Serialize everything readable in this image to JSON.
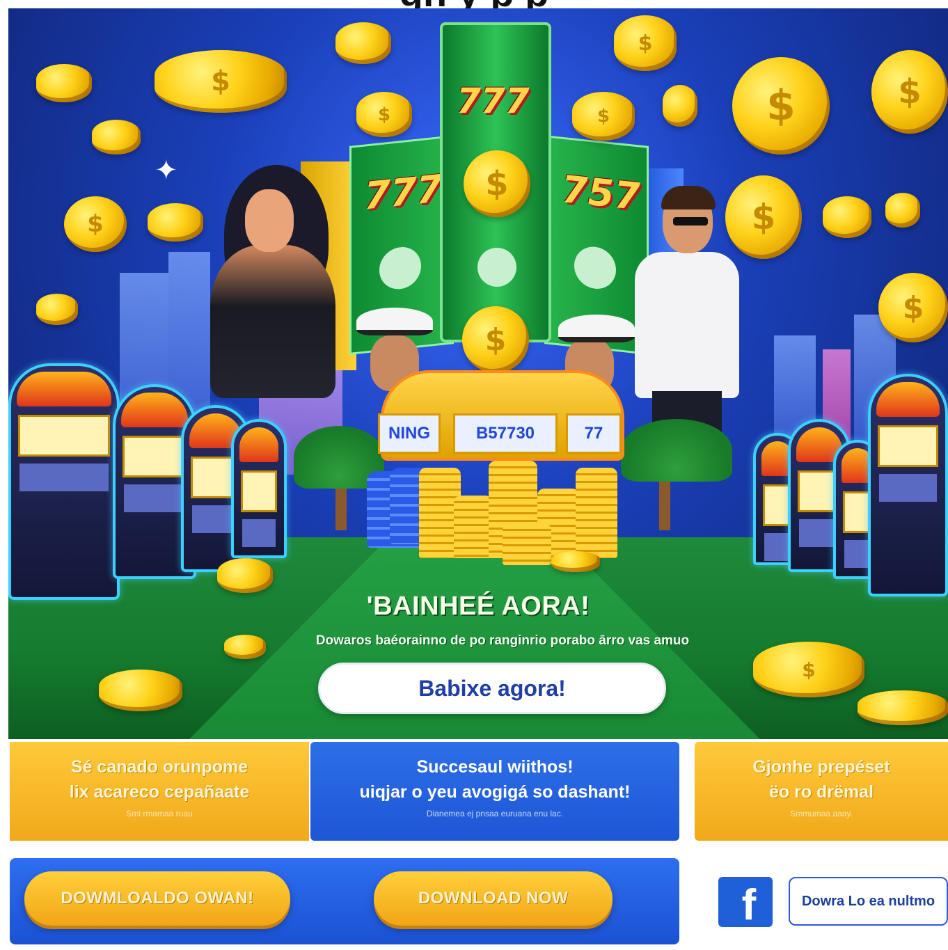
{
  "page": {
    "title": "gn y p p"
  },
  "hero": {
    "sign_text": "B57730",
    "sign_left": "NING",
    "sign_right": "77",
    "reel_left": "777",
    "reel_center": "777",
    "reel_right": "757",
    "coin_symbol": "$",
    "title": "'BAINHEÉ AORA!",
    "subtitle": "Dowaros baéorainno de po ranginrio porabo ārro vas amuo",
    "cta_label": "Babixe agora!"
  },
  "cards": [
    {
      "title_line1": "Sé canado orunpome",
      "title_line2": "lix acareco cepañaate",
      "sub": "Smi rmamaa ruau"
    },
    {
      "title_line1": "Succesaul wiithos!",
      "title_line2": "uiqjar o yeu avogigá so dashant!",
      "sub": "Dianemea ej pnsaa euruana enu lac."
    },
    {
      "title_line1": "Gjonhe prepéset",
      "title_line2": "ëo ro drëmal",
      "sub": "Smmumaa aaay."
    }
  ],
  "bottom": {
    "download_left": "DOWMLOALDO OWAN!",
    "download_right": "DOWNLOAD NOW",
    "facebook_glyph": "f",
    "side_button": "Dowra Lo ea nultmo"
  },
  "colors": {
    "brand_blue": "#1f56d8",
    "accent_yellow": "#f5b21e",
    "felt_green": "#1a8a36"
  }
}
